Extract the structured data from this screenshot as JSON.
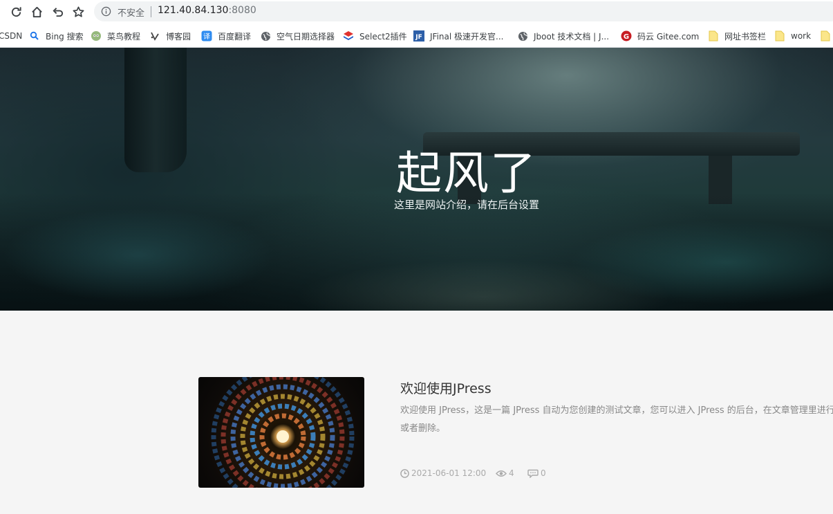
{
  "browser": {
    "nav_icons": [
      "reload-icon",
      "home-icon",
      "back-icon",
      "star-icon"
    ],
    "omnibox": {
      "security_label": "不安全",
      "host": "121.40.84.130",
      "port": ":8080"
    },
    "bookmarks": [
      {
        "label": "CSDN",
        "icon": "none"
      },
      {
        "label": "Bing 搜索",
        "icon": "search-icon"
      },
      {
        "label": "菜鸟教程",
        "icon": "runoob-icon"
      },
      {
        "label": "博客园",
        "icon": "cnblogs-icon"
      },
      {
        "label": "百度翻译",
        "icon": "translate-icon"
      },
      {
        "label": "空气日期选择器",
        "icon": "globe-icon"
      },
      {
        "label": "Select2插件",
        "icon": "layers-icon"
      },
      {
        "label": "JFinal 极速开发官...",
        "icon": "jfinal-icon"
      },
      {
        "label": "Jboot 技术文档 | J...",
        "icon": "globe-icon"
      },
      {
        "label": "码云 Gitee.com",
        "icon": "gitee-icon"
      },
      {
        "label": "网址书签栏",
        "icon": "folder-icon"
      },
      {
        "label": "work",
        "icon": "folder-icon"
      }
    ]
  },
  "hero": {
    "title": "起风了",
    "subtitle": "这里是网站介绍，请在后台设置"
  },
  "article": {
    "title": "欢迎使用JPress",
    "summary": "欢迎使用 JPress，这是一篇 JPress 自动为您创建的测试文章，您可以进入 JPress 的后台，在文章管理里进行修改或者删除。",
    "date": "2021-06-01 12:00",
    "views": "4",
    "comments": "0"
  },
  "colors": {
    "page_bg": "#f5f5f5",
    "title_text": "#333333",
    "muted_text": "#888888"
  }
}
